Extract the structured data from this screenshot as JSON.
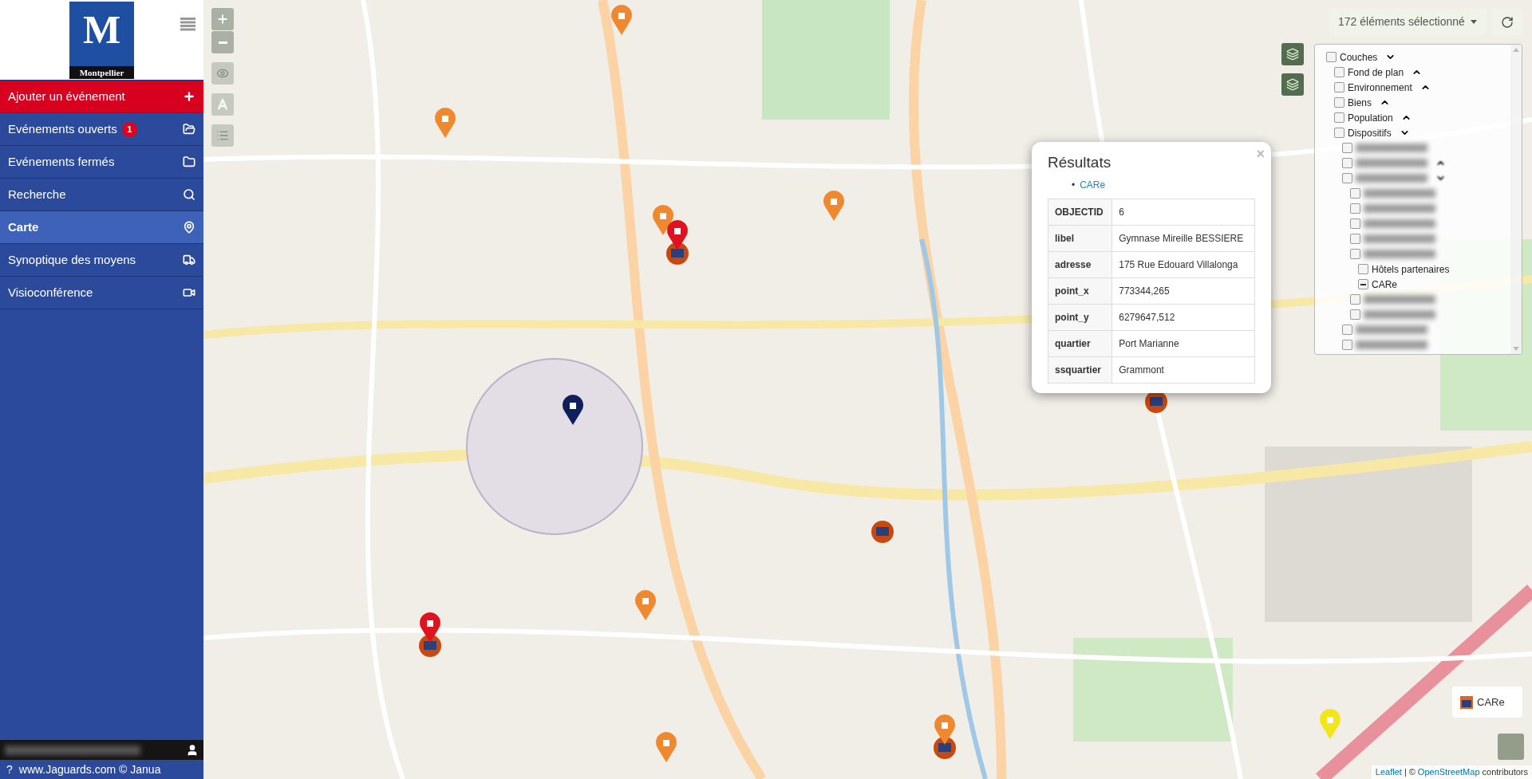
{
  "sidebar": {
    "logo": {
      "letter": "M",
      "name": "Montpellier"
    },
    "items": [
      {
        "kind": "action",
        "label": "Ajouter un événement",
        "selected": false
      },
      {
        "kind": "nav",
        "label": "Evénements ouverts",
        "badge": "1",
        "selected": false
      },
      {
        "kind": "nav",
        "label": "Evénements fermés",
        "selected": false
      },
      {
        "kind": "nav",
        "label": "Recherche",
        "selected": false
      },
      {
        "kind": "nav",
        "label": "Carte",
        "selected": true
      },
      {
        "kind": "nav",
        "label": "Synoptique des moyens",
        "selected": false
      },
      {
        "kind": "nav",
        "label": "Visioconférence",
        "selected": false
      }
    ],
    "footer": {
      "help": "?",
      "text": "www.Jaguards.com © Janua"
    }
  },
  "map": {
    "selection_dropdown": "172 éléments sélectionné",
    "layers": [
      {
        "kind": "layer",
        "label": "Couches",
        "checked": false,
        "expanded": true,
        "children": [
          {
            "kind": "layer",
            "label": "Fond de plan",
            "checked": false,
            "expanded": false
          },
          {
            "kind": "layer",
            "label": "Environnement",
            "checked": false,
            "expanded": false
          },
          {
            "kind": "layer",
            "label": "Biens",
            "checked": false,
            "expanded": false
          },
          {
            "kind": "layer",
            "label": "Population",
            "checked": false,
            "expanded": false
          },
          {
            "kind": "layer",
            "label": "Dispositifs",
            "checked": false,
            "expanded": true,
            "children": [
              {
                "kind": "blurred",
                "checked": false
              },
              {
                "kind": "blurred",
                "checked": false,
                "expanded": false
              },
              {
                "kind": "blurred",
                "checked": false,
                "expanded": true,
                "children": [
                  {
                    "kind": "blurred",
                    "checked": false
                  },
                  {
                    "kind": "blurred",
                    "checked": false
                  },
                  {
                    "kind": "blurred",
                    "checked": false
                  },
                  {
                    "kind": "blurred",
                    "checked": false
                  },
                  {
                    "kind": "blurred",
                    "checked": false,
                    "children": [
                      {
                        "kind": "layer",
                        "label": "Hôtels partenaires",
                        "checked": false
                      },
                      {
                        "kind": "layer",
                        "label": "CARe",
                        "checked": false,
                        "indeterminate": true
                      }
                    ]
                  },
                  {
                    "kind": "blurred",
                    "checked": false
                  },
                  {
                    "kind": "blurred",
                    "checked": false
                  }
                ]
              },
              {
                "kind": "blurred",
                "checked": false
              },
              {
                "kind": "blurred",
                "checked": false
              }
            ]
          }
        ]
      }
    ],
    "popup": {
      "title": "Résultats",
      "close": "×",
      "bullet": "•",
      "links": [
        "CARe"
      ],
      "rows": [
        {
          "key": "OBJECTID",
          "value": "6"
        },
        {
          "key": "libel",
          "value": "Gymnase Mireille BESSIERE"
        },
        {
          "key": "adresse",
          "value": "175 Rue Edouard Villalonga"
        },
        {
          "key": "point_x",
          "value": "773344,265"
        },
        {
          "key": "point_y",
          "value": "6279647,512"
        },
        {
          "key": "quartier",
          "value": "Port Marianne"
        },
        {
          "key": "ssquartier",
          "value": "Grammont"
        }
      ]
    },
    "legend": {
      "label": "CARe"
    },
    "attribution": {
      "links": [
        "Leaflet",
        "OpenStreetMap"
      ],
      "separator": "|",
      "copyright": "©",
      "suffix": "contributors"
    }
  }
}
